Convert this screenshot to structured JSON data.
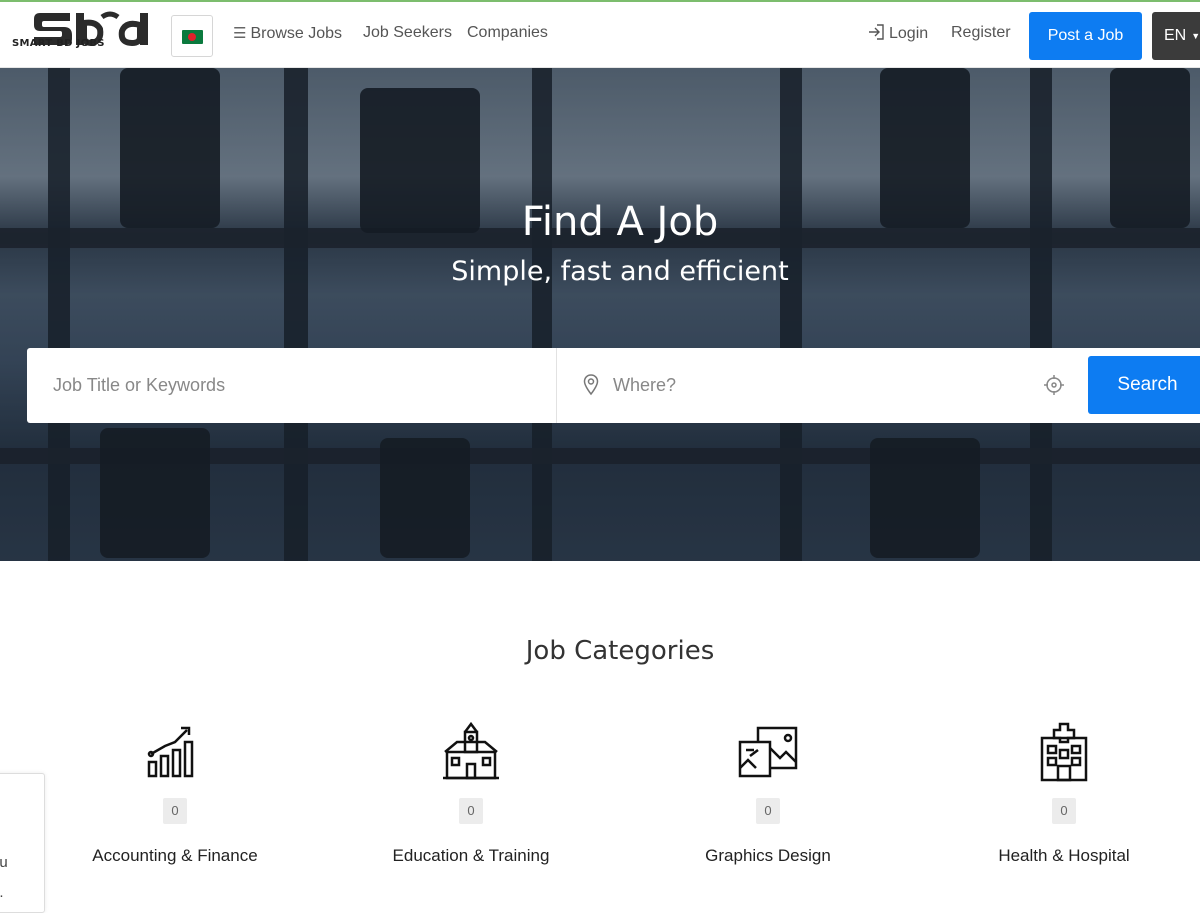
{
  "brand": {
    "logo_text": "SMART BD JOBS",
    "flag": "bangladesh-flag"
  },
  "nav": {
    "browse_jobs": "Browse Jobs",
    "job_seekers": "Job Seekers",
    "companies": "Companies",
    "login": "Login",
    "register": "Register",
    "post_job": "Post a Job",
    "language": "EN"
  },
  "hero": {
    "title": "Find A Job",
    "subtitle": "Simple, fast and efficient",
    "keyword_placeholder": "Job Title or Keywords",
    "location_placeholder": "Where?",
    "search_label": "Search"
  },
  "categories": {
    "title": "Job Categories",
    "items": [
      {
        "name": "Accounting & Finance",
        "count": "0",
        "icon": "chart-growth-icon"
      },
      {
        "name": "Education & Training",
        "count": "0",
        "icon": "school-building-icon"
      },
      {
        "name": "Graphics Design",
        "count": "0",
        "icon": "picture-frames-icon"
      },
      {
        "name": "Health & Hospital",
        "count": "0",
        "icon": "hospital-icon"
      }
    ]
  },
  "cookie": {
    "line1": "ou",
    "line2": "e."
  },
  "colors": {
    "primary": "#0d7cf2",
    "lang_bg": "#3b3b3b",
    "accent_top": "#7cbd6d"
  }
}
